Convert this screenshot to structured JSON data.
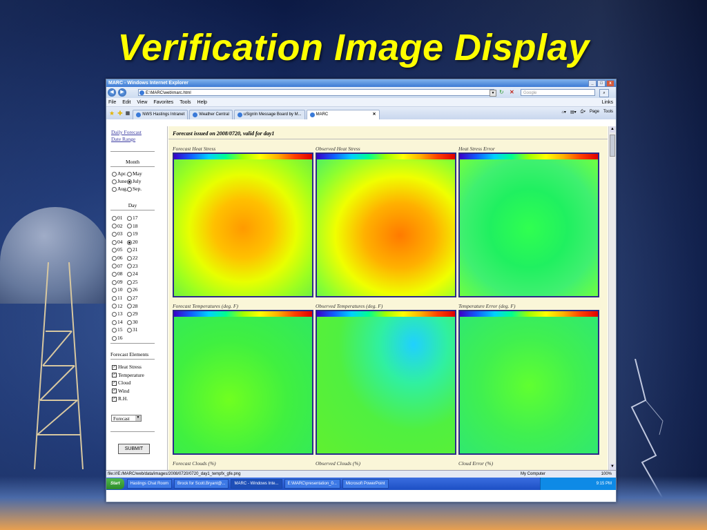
{
  "slide": {
    "title": "Verification Image Display"
  },
  "browser": {
    "window_title": "MARC - Windows Internet Explorer",
    "address": "E:\\MARC\\web\\marc.html",
    "search_placeholder": "Google",
    "menu": [
      "File",
      "Edit",
      "View",
      "Favorites",
      "Tools",
      "Help"
    ],
    "links_label": "Links",
    "tabs": [
      {
        "label": "NWS Hastings Intranet",
        "active": false
      },
      {
        "label": "Weather Central",
        "active": false
      },
      {
        "label": "uSignIn Message Board by M...",
        "active": false
      },
      {
        "label": "MARC",
        "active": true
      }
    ],
    "page_menu": "Page",
    "tools_menu": "Tools",
    "status_url": "file:///E:/MARC/web/data/images/2008/0720/0720_day1_tempfx_gfe.png",
    "status_zone": "My Computer",
    "zoom": "100%"
  },
  "left_panel": {
    "links": [
      "Daily Forecast",
      "Date Range"
    ],
    "month_header": "Month",
    "months": [
      {
        "label": "Apr.",
        "checked": false
      },
      {
        "label": "May",
        "checked": false
      },
      {
        "label": "June",
        "checked": false
      },
      {
        "label": "July",
        "checked": true
      },
      {
        "label": "Aug.",
        "checked": false
      },
      {
        "label": "Sep.",
        "checked": false
      }
    ],
    "day_header": "Day",
    "days_left": [
      "01",
      "02",
      "03",
      "04",
      "05",
      "06",
      "07",
      "08",
      "09",
      "10",
      "11",
      "12",
      "13",
      "14",
      "15",
      "16"
    ],
    "days_right": [
      "17",
      "18",
      "19",
      "20",
      "21",
      "22",
      "23",
      "24",
      "25",
      "26",
      "27",
      "28",
      "29",
      "30",
      "31"
    ],
    "selected_day": "20",
    "elements_header": "Forecast Elements",
    "elements": [
      {
        "label": "Heat Stress",
        "checked": true
      },
      {
        "label": "Temperature",
        "checked": true
      },
      {
        "label": "Cloud",
        "checked": true
      },
      {
        "label": "Wind",
        "checked": true
      },
      {
        "label": "R.H.",
        "checked": true
      }
    ],
    "select_value": "Forecast",
    "submit_label": "SUBMIT"
  },
  "main": {
    "forecast_title": "Forecast issued on 2008/0720, valid for day1",
    "row1_labels": [
      "Forecast Heat Stress",
      "Observed Heat Stress",
      "Heat Stress Error"
    ],
    "row2_labels": [
      "Forecast Temperatures (deg. F)",
      "Observed Temperatures (deg. F)",
      "Temperature Error (deg. F)"
    ],
    "row3_labels": [
      "Forecast Clouds (%)",
      "Observed Clouds (%)",
      "Cloud Error (%)"
    ]
  },
  "taskbar": {
    "start_label": "Start",
    "items": [
      {
        "label": "Hastings Chat Room",
        "active": false
      },
      {
        "label": "Brock for Scott.Bryant@...",
        "active": false
      },
      {
        "label": "MARC - Windows Inte...",
        "active": true
      },
      {
        "label": "E:\\MARC\\presentation_0...",
        "active": false
      },
      {
        "label": "Microsoft PowerPoint",
        "active": false
      }
    ],
    "clock": "9:15 PM"
  },
  "colors": {
    "title_yellow": "#ffff00",
    "background_blue": "#1c3470",
    "page_cream": "#faf6d8"
  }
}
